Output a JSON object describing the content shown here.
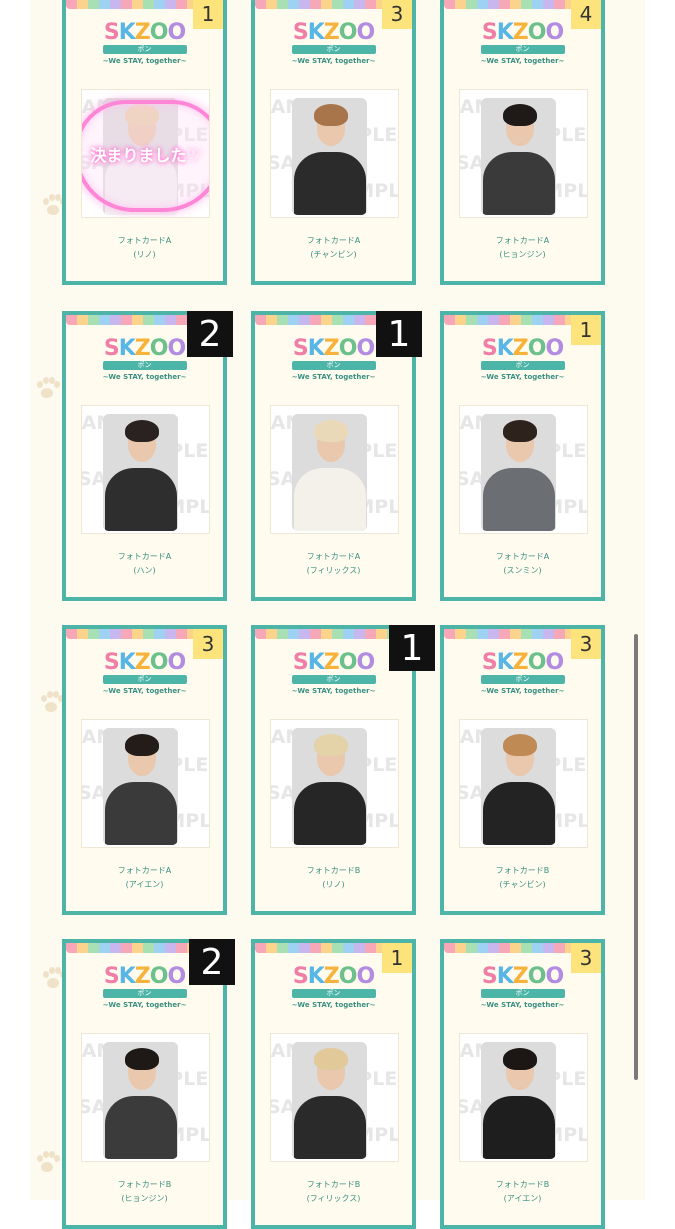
{
  "logo": {
    "letters": [
      "S",
      "K",
      "Z",
      "O",
      "O"
    ],
    "ribbon": "ポン",
    "subtitle": "~We STAY, together~"
  },
  "sample_watermark": "SAMPLE",
  "decided_overlay": "決まりました♡",
  "cards": [
    {
      "badge": "1",
      "badge_style": "yellow",
      "type": "フォトカードA",
      "member": "(リノ)",
      "hair": "#e8d0a8",
      "body": "#f2f2f2",
      "decided": true
    },
    {
      "badge": "3",
      "badge_style": "yellow",
      "type": "フォトカードA",
      "member": "(チャンビン)",
      "hair": "#a8744a",
      "body": "#2b2b2b"
    },
    {
      "badge": "4",
      "badge_style": "yellow",
      "type": "フォトカードA",
      "member": "(ヒョンジン)",
      "hair": "#1f1a18",
      "body": "#3a3a3a"
    },
    {
      "badge": "2",
      "badge_style": "black",
      "type": "フォトカードA",
      "member": "(ハン)",
      "hair": "#2a2220",
      "body": "#2e2e2e"
    },
    {
      "badge": "1",
      "badge_style": "black",
      "type": "フォトカードA",
      "member": "(フィリックス)",
      "hair": "#ead9b8",
      "body": "#f4f0ea"
    },
    {
      "badge": "1",
      "badge_style": "yellow",
      "type": "フォトカードA",
      "member": "(スンミン)",
      "hair": "#2e221c",
      "body": "#6b6e72"
    },
    {
      "badge": "3",
      "badge_style": "yellow",
      "type": "フォトカードA",
      "member": "(アイエン)",
      "hair": "#231c18",
      "body": "#3a3a3a"
    },
    {
      "badge": "1",
      "badge_style": "black",
      "type": "フォトカードB",
      "member": "(リノ)",
      "hair": "#e4d2a8",
      "body": "#262626"
    },
    {
      "badge": "3",
      "badge_style": "yellow",
      "type": "フォトカードB",
      "member": "(チャンビン)",
      "hair": "#c08a55",
      "body": "#232323"
    },
    {
      "badge": "2",
      "badge_style": "black",
      "type": "フォトカードB",
      "member": "(ヒョンジン)",
      "hair": "#1e1816",
      "body": "#3b3b3b"
    },
    {
      "badge": "1",
      "badge_style": "yellow",
      "type": "フォトカードB",
      "member": "(フィリックス)",
      "hair": "#e2c99a",
      "body": "#2a2a2a"
    },
    {
      "badge": "3",
      "badge_style": "yellow",
      "type": "フォトカードB",
      "member": "(アイエン)",
      "hair": "#1c1715",
      "body": "#1e1e1e"
    }
  ],
  "colors": {
    "card_border": "#4db5a7",
    "badge_yellow": "#fce37b",
    "badge_black": "#111111",
    "page_bg": "#fdfbf0"
  }
}
